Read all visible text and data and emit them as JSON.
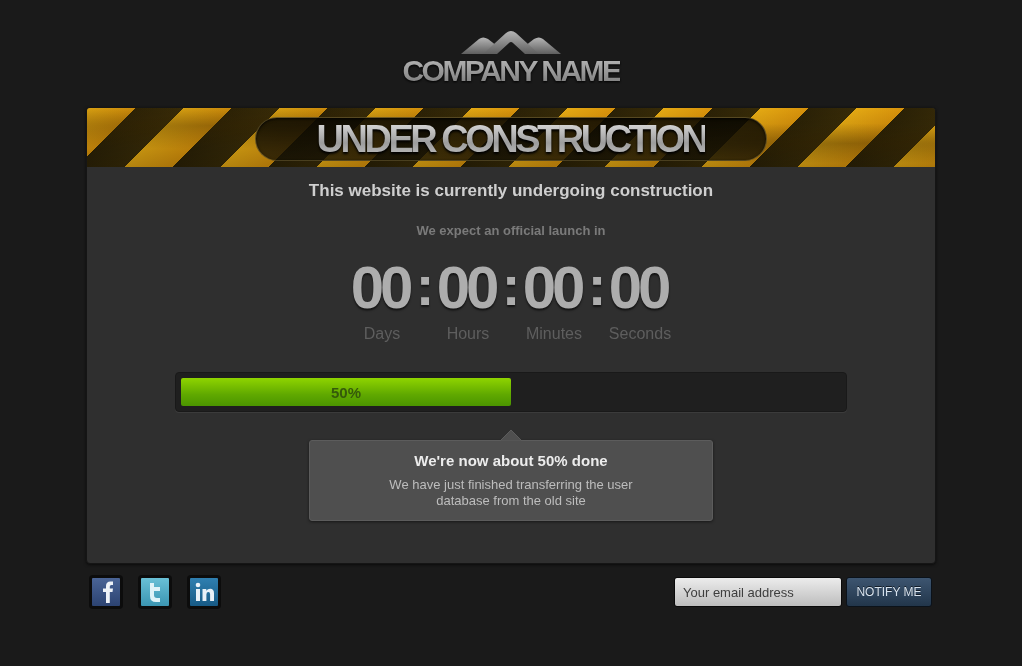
{
  "logo": {
    "text": "COMPANY NAME"
  },
  "banner": {
    "title": "UNDER CONSTRUCTION"
  },
  "headline": "This website is currently undergoing construction",
  "launch_note": "We expect an official launch in",
  "countdown": {
    "units": [
      {
        "value": "00",
        "label": "Days"
      },
      {
        "value": "00",
        "label": "Hours"
      },
      {
        "value": "00",
        "label": "Minutes"
      },
      {
        "value": "00",
        "label": "Seconds"
      }
    ],
    "separators": [
      ":",
      ":",
      ":"
    ]
  },
  "progress": {
    "level": 0.5,
    "label": "50%"
  },
  "tooltip": {
    "title": "We're now about 50% done",
    "text": "We have just finished transferring the user database from the old site"
  },
  "newsletter": {
    "placeholder": "Your email address",
    "button": "NOTIFY ME"
  }
}
